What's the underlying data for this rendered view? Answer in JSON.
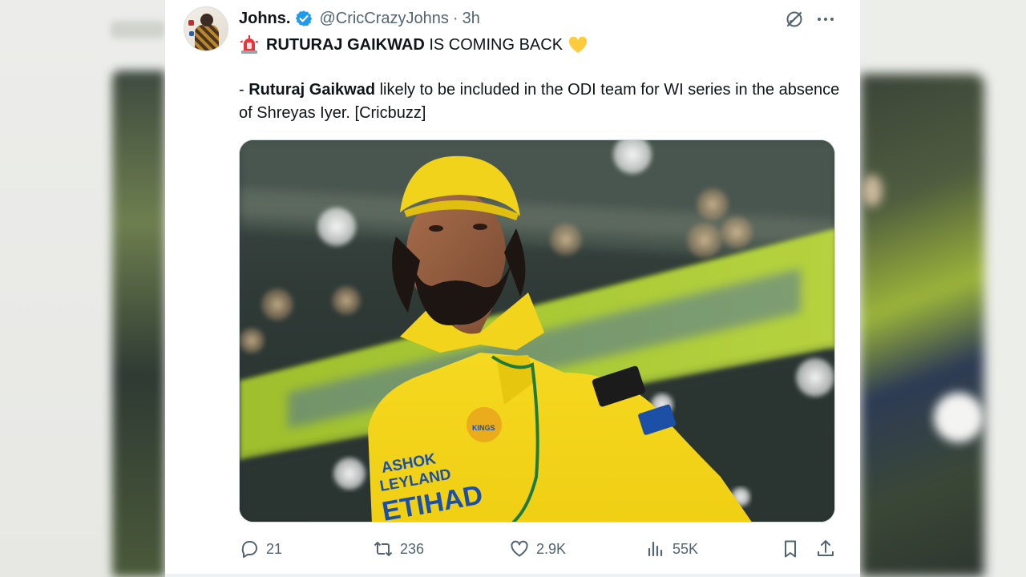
{
  "tweet": {
    "author": {
      "display_name": "Johns.",
      "handle": "@CricCrazyJohns",
      "verified": true
    },
    "separator": "·",
    "time": "3h",
    "headline": {
      "emoji_start": "siren",
      "bold_text": "RUTURAJ GAIKWAD",
      "rest_text": " IS COMING BACK",
      "emoji_end": "yellow-heart"
    },
    "body": {
      "prefix": "- ",
      "bold_name": "Ruturaj Gaikwad",
      "rest": " likely to be included in the ODI team for WI series in the absence of Shreyas Iyer. [Cricbuzz]"
    },
    "media": {
      "description": "photo",
      "jersey_texts": [
        "ASHOK LEYLAND",
        "ETIHAD",
        "SUPER KINGS"
      ]
    },
    "actions": {
      "replies": "21",
      "reposts": "236",
      "likes": "2.9K",
      "views": "55K"
    }
  },
  "colors": {
    "text_primary": "#0f1419",
    "text_secondary": "#536471",
    "verified_blue": "#1d9bf0",
    "jersey_yellow": "#f5d820"
  },
  "icons": [
    "grok-icon",
    "more-icon",
    "reply-icon",
    "repost-icon",
    "like-icon",
    "views-icon",
    "bookmark-icon",
    "share-icon",
    "verified-badge-icon",
    "siren-emoji-icon",
    "yellow-heart-emoji-icon"
  ]
}
